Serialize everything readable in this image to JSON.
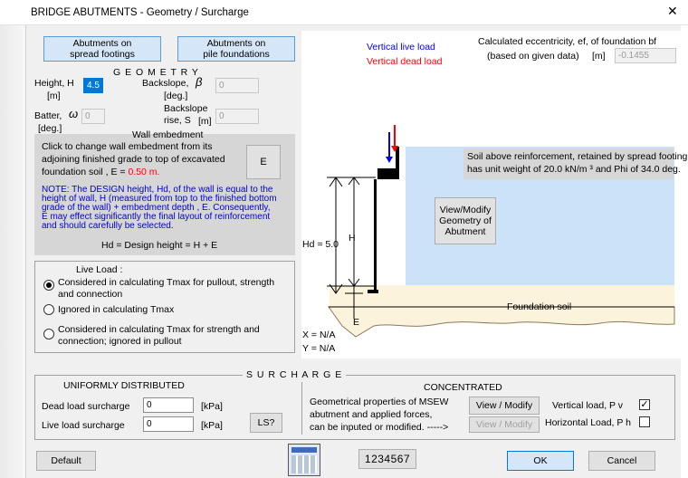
{
  "window": {
    "title": "BRIDGE ABUTMENTS - Geometry / Surcharge",
    "close_glyph": "✕"
  },
  "top_buttons": {
    "spread_line1": "Abutments on",
    "spread_line2": "spread footings",
    "pile_line1": "Abutments on",
    "pile_line2": "pile foundations"
  },
  "geometry": {
    "header": "G E O M E T R Y",
    "height_label": "Height, H",
    "height_unit": "[m]",
    "height_value": "4.5",
    "backslope_label": "Backslope,",
    "backslope_symbol": "β",
    "backslope_unit": "[deg.]",
    "backslope_value": "0",
    "batter_label": "Batter,",
    "batter_symbol": "ω",
    "batter_unit": "[deg.]",
    "batter_value": "0",
    "backslope_rise_line1": "Backslope",
    "backslope_rise_line2": "rise, S",
    "backslope_rise_unit": "[m]",
    "backslope_rise_value": "0"
  },
  "embedment": {
    "header": "Wall embedment",
    "text1": "Click to change wall embedment from its",
    "text2": "adjoining finished grade to top of excavated",
    "text3_prefix": "foundation soil ,   E = ",
    "text3_value": "0.50 m.",
    "button_label": "E",
    "note1": "NOTE: The DESIGN height, Hd, of the wall is equal to the",
    "note2": "height of wall, H (measured from top to the finished bottom",
    "note3": "grade of the wall) + embedment depth , E.  Consequently,",
    "note4": "E may effect significantly the final layout of reinforcement",
    "note5": "and should carefully be selected.",
    "formula": "Hd = Design height = H + E"
  },
  "live_load": {
    "header": "Live Load :",
    "opt1_line1": "Considered in calculating Tmax for pullout, strength",
    "opt1_line2": "and connection",
    "opt2": "Ignored in calculating Tmax",
    "opt3_line1": "Considered in calculating Tmax for strength and",
    "opt3_line2": "connection; ignored in pullout",
    "selected": 1
  },
  "diagram": {
    "vertical_live_load": "Vertical live load",
    "vertical_dead_load": "Vertical dead load",
    "eccentricity_line1": "Calculated eccentricity,  ef, of foundation bf",
    "eccentricity_line2": "(based on given data)",
    "eccentricity_unit": "[m]",
    "eccentricity_value": "-0.1455",
    "soil_note_line1": "Soil above reinforcement, retained by spread footing,",
    "soil_note_line2": "has unit weight of 20.0 kN/m ³  and Phi of 34.0 deg.",
    "view_modify_line1": "View/Modify",
    "view_modify_line2": "Geometry of",
    "view_modify_line3": "Abutment",
    "hd_label": "Hd = 5.0",
    "h_label": "H",
    "e_label": "E",
    "foundation_soil": "Foundation soil",
    "x_readout": "X = N/A",
    "y_readout": "Y = N/A",
    "colors": {
      "soil_fill": "#cce2f8",
      "foundation_fill": "#fbf3dc",
      "note_fill": "#d6d6d6",
      "live_load": "#0000ff",
      "dead_load": "#ff0000"
    }
  },
  "surcharge": {
    "header": "S U R C H A R G E",
    "uniform_header": "UNIFORMLY  DISTRIBUTED",
    "dead_label": "Dead load surcharge",
    "dead_value": "0",
    "dead_unit": "[kPa]",
    "live_label": "Live load surcharge",
    "live_value": "0",
    "live_unit": "[kPa]",
    "ls_button": "LS?",
    "concentrated_header": "CONCENTRATED",
    "conc_text1": "Geometrical properties of MSEW",
    "conc_text2": "abutment and applied forces,",
    "conc_text3": "  can be inputed or modified. ----->",
    "view_modify1": "View / Modify",
    "view_modify2": "View / Modify",
    "vertical_load_label": "Vertical load,  P v",
    "vertical_load_checked": true,
    "horizontal_load_label": "Horizontal  Load,  P h",
    "horizontal_load_checked": false
  },
  "bottom": {
    "default_label": "Default",
    "numpad_label": "1234567",
    "ok_label": "OK",
    "cancel_label": "Cancel"
  }
}
